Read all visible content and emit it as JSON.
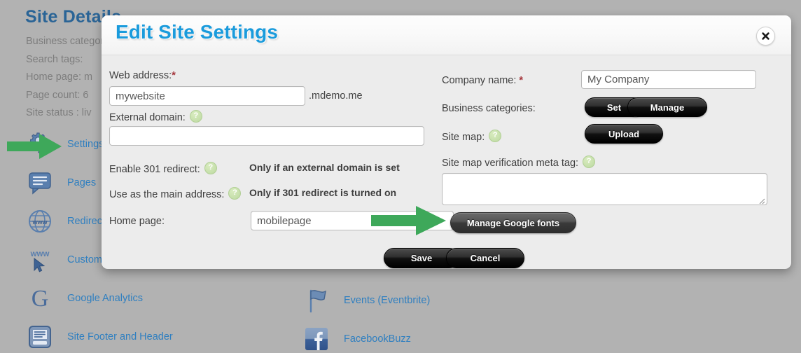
{
  "background": {
    "page_title": "Site Details",
    "meta": [
      {
        "label": "Business categories:",
        "value": ""
      },
      {
        "label": "Search tags:",
        "value": ""
      },
      {
        "label": "Home page: m",
        "value": ""
      },
      {
        "label": "Page count: 6",
        "value": ""
      },
      {
        "label": "Site status : liv",
        "value": ""
      }
    ],
    "left_items": [
      {
        "label": "Settings",
        "icon": "gears-icon"
      },
      {
        "label": "Pages",
        "icon": "pages-icon"
      },
      {
        "label": "Redirects",
        "icon": "globe-www-icon"
      },
      {
        "label": "Custom domain",
        "icon": "www-cursor-icon"
      },
      {
        "label": "Google Analytics",
        "icon": "google-g-icon"
      },
      {
        "label": "Site Footer and Header",
        "icon": "footer-header-icon"
      }
    ],
    "right_items": [
      {
        "label": "Events (Eventbrite)",
        "icon": "flag-icon"
      },
      {
        "label": "FacebookBuzz",
        "icon": "facebook-icon"
      }
    ]
  },
  "modal": {
    "title": "Edit Site Settings",
    "close_label": "Close",
    "left": {
      "web_address_label": "Web address:",
      "web_address_required": "*",
      "web_address_value": "mywebsite",
      "web_address_suffix": ".mdemo.me",
      "external_domain_label": "External domain:",
      "external_domain_value": "",
      "enable_301_label": "Enable 301 redirect:",
      "enable_301_note": "Only if an external domain is set",
      "main_address_label": "Use as the main address:",
      "main_address_note": "Only if 301 redirect is turned on",
      "home_page_label": "Home page:",
      "home_page_value": "mobilepage"
    },
    "right": {
      "company_name_label": "Company name:",
      "company_name_required": "*",
      "company_name_value": "My Company",
      "business_categories_label": "Business categories:",
      "set_button": "Set",
      "manage_button": "Manage",
      "site_map_label": "Site map:",
      "upload_button": "Upload",
      "meta_tag_label": "Site map verification meta tag:",
      "meta_tag_value": ""
    },
    "manage_fonts_button": "Manage Google fonts",
    "save_button": "Save",
    "cancel_button": "Cancel"
  },
  "colors": {
    "accent_blue": "#1a9bdc",
    "link_blue": "#2f7fc0",
    "arrow_green": "#3ea85a",
    "required_red": "#a4343a",
    "backdrop_gray": "#b2b2b2",
    "modal_body": "#ececec"
  }
}
